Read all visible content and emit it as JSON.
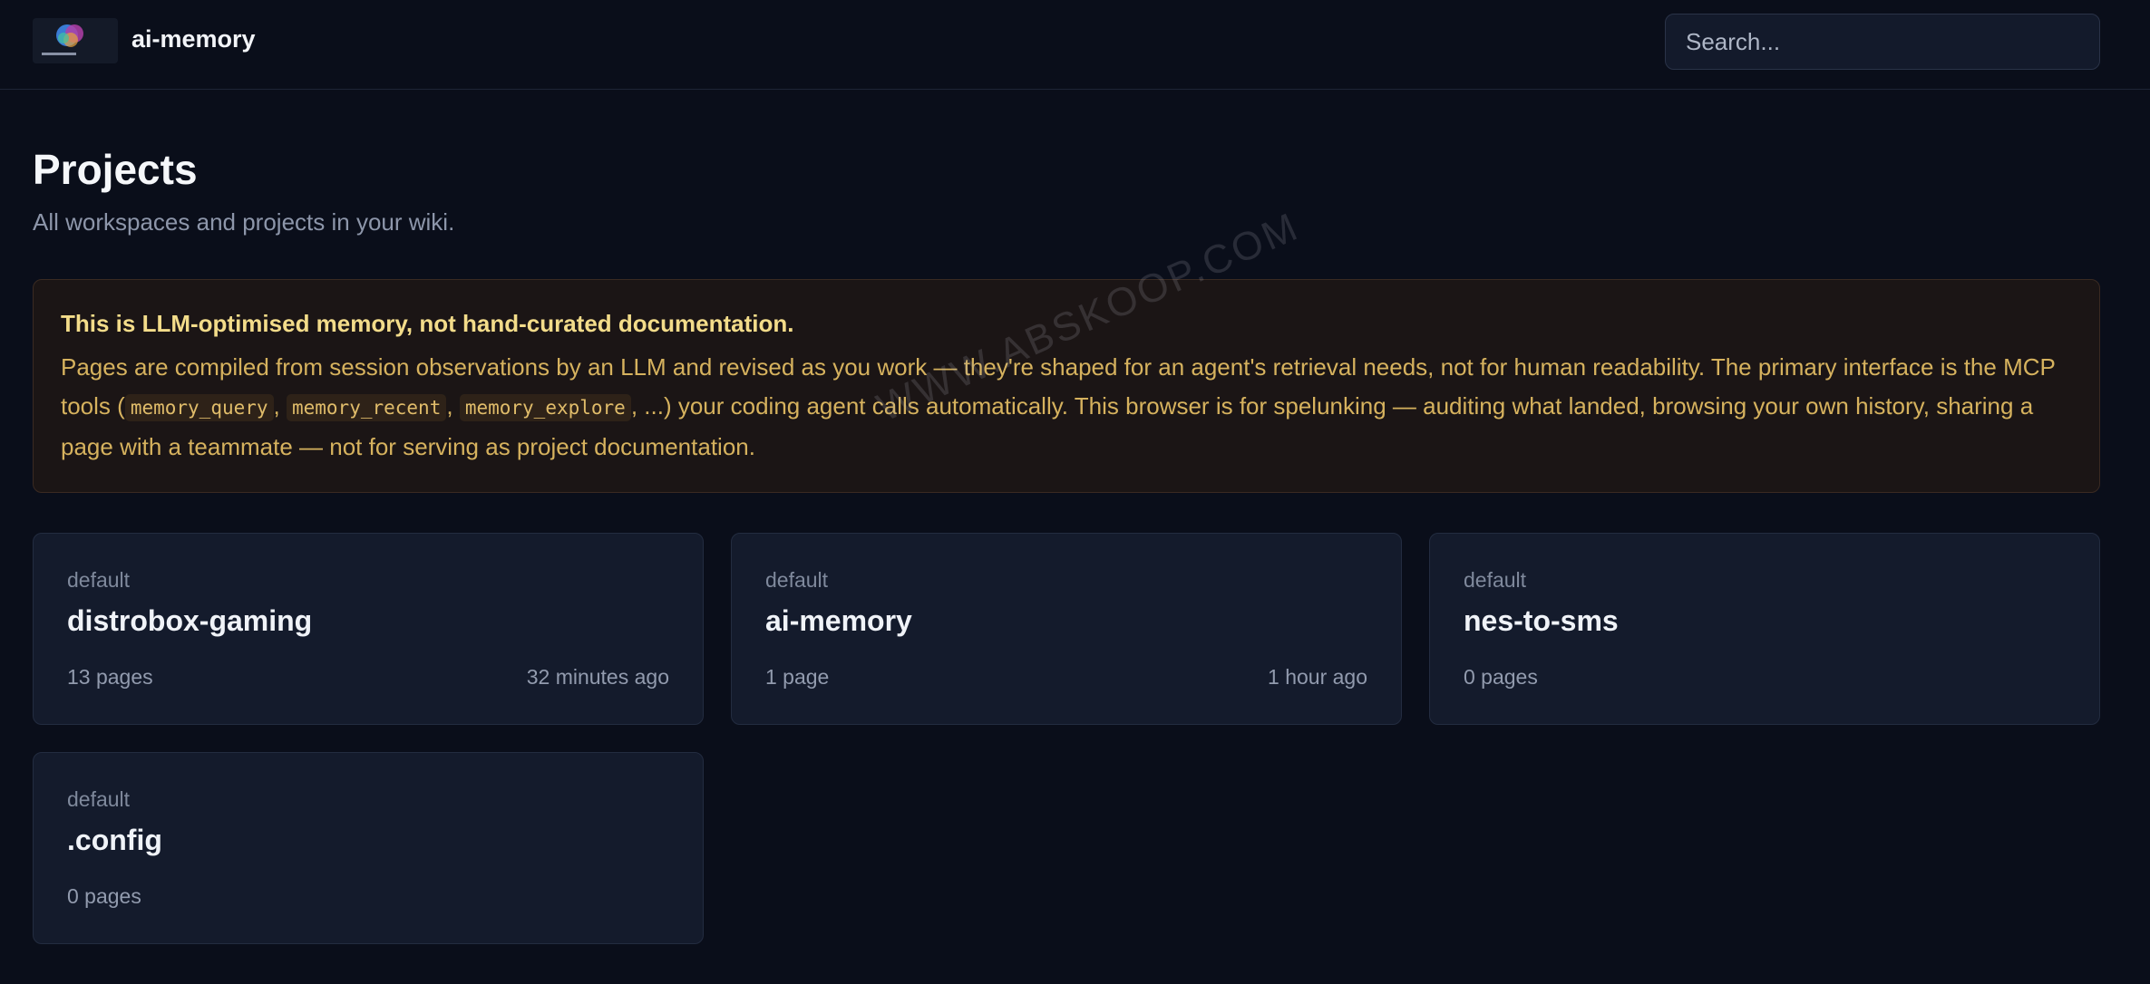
{
  "header": {
    "brand": "ai-memory",
    "search_placeholder": "Search..."
  },
  "main": {
    "title": "Projects",
    "subtitle": "All workspaces and projects in your wiki."
  },
  "notice": {
    "title": "This is LLM-optimised memory, not hand-curated documentation.",
    "text_1": "Pages are compiled from session observations by an LLM and revised as you work — they're shaped for an agent's retrieval needs, not for human readability. The primary interface is the MCP tools (",
    "tool_1": "memory_query",
    "sep_1": ", ",
    "tool_2": "memory_recent",
    "sep_2": ", ",
    "tool_3": "memory_explore",
    "text_2": ", ...) your coding agent calls automatically. This browser is for spelunking — auditing what landed, browsing your own history, sharing a page with a teammate — not for serving as project documentation."
  },
  "projects": [
    {
      "workspace": "default",
      "name": "distrobox-gaming",
      "pages": "13 pages",
      "updated": "32 minutes ago"
    },
    {
      "workspace": "default",
      "name": "ai-memory",
      "pages": "1 page",
      "updated": "1 hour ago"
    },
    {
      "workspace": "default",
      "name": "nes-to-sms",
      "pages": "0 pages",
      "updated": ""
    },
    {
      "workspace": "default",
      "name": ".config",
      "pages": "0 pages",
      "updated": ""
    }
  ],
  "watermark": "WWW.ABSKOOP.COM",
  "colors": {
    "background": "#0a0e1a",
    "card": "#141b2c",
    "notice_bg": "#1b1515",
    "notice_title": "#f3dc8a",
    "notice_text": "#d6b25e"
  }
}
